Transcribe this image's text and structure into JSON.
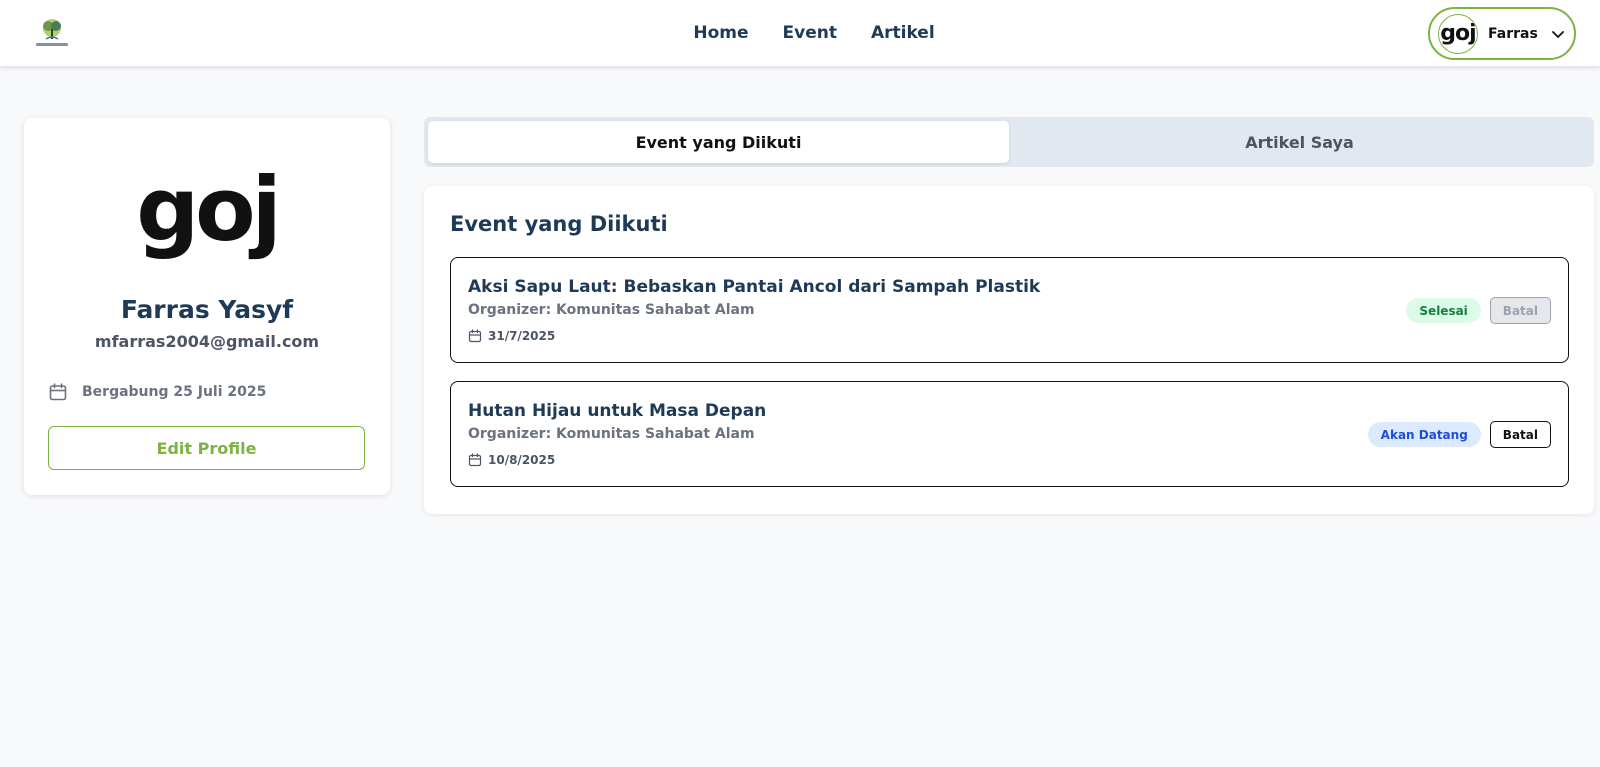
{
  "header": {
    "nav": [
      "Home",
      "Event",
      "Artikel"
    ],
    "user": {
      "avatar_text": "goj",
      "name": "Farras"
    }
  },
  "profile": {
    "avatar_text": "goj",
    "name": "Farras Yasyf",
    "email": "mfarras2004@gmail.com",
    "joined": "Bergabung 25 Juli 2025",
    "edit_label": "Edit Profile"
  },
  "tabs": [
    {
      "label": "Event yang Diikuti",
      "active": true
    },
    {
      "label": "Artikel Saya",
      "active": false
    }
  ],
  "events_panel": {
    "title": "Event yang Diikuti",
    "events": [
      {
        "title": "Aksi Sapu Laut: Bebaskan Pantai Ancol dari Sampah Plastik",
        "organizer": "Organizer: Komunitas Sahabat Alam",
        "date": "31/7/2025",
        "status": "Selesai",
        "cancel_label": "Batal"
      },
      {
        "title": "Hutan Hijau untuk Masa Depan",
        "organizer": "Organizer: Komunitas Sahabat Alam",
        "date": "10/8/2025",
        "status": "Akan Datang",
        "cancel_label": "Batal"
      }
    ]
  },
  "colors": {
    "accent": "#7cb342",
    "heading": "#1e3a56",
    "done_badge_bg": "#dcfce7",
    "upcoming_badge_bg": "#dbeafe"
  }
}
